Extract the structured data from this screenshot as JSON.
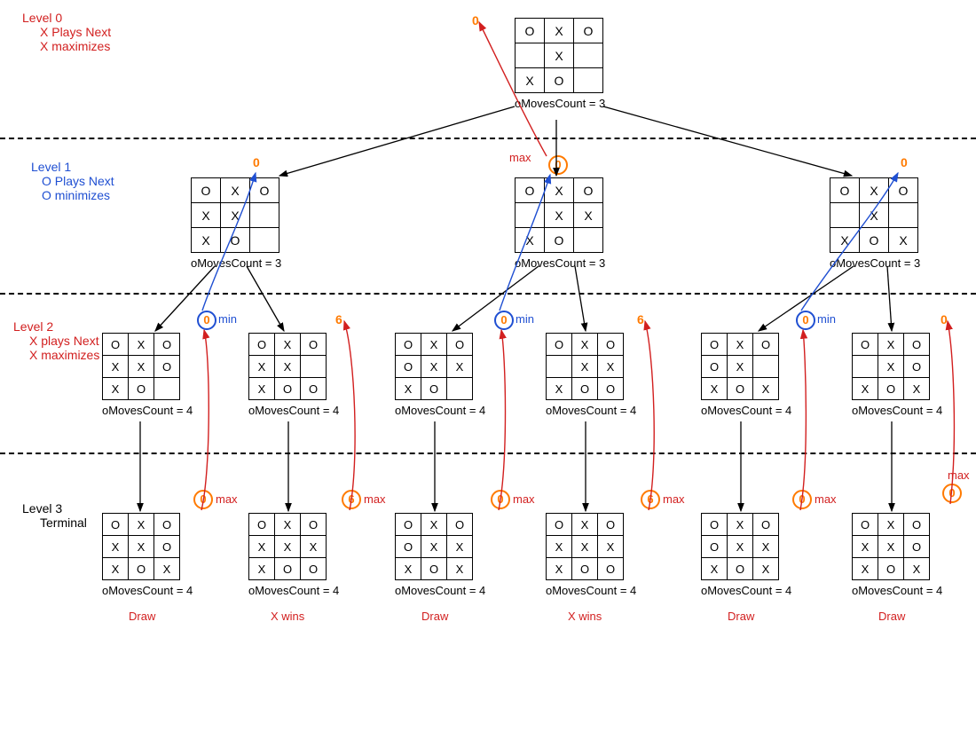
{
  "levels": {
    "l0": {
      "title": "Level 0",
      "line1": "X Plays Next",
      "line2": "X maximizes"
    },
    "l1": {
      "title": "Level 1",
      "line1": "O Plays Next",
      "line2": "O minimizes"
    },
    "l2": {
      "title": "Level 2",
      "line1": "X plays Next",
      "line2": "X maximizes"
    },
    "l3": {
      "title": "Level 3",
      "line1": "Terminal"
    }
  },
  "labels": {
    "max": "max",
    "min": "min",
    "oMoves3": "oMovesCount = 3",
    "oMoves4": "oMovesCount = 4"
  },
  "values": {
    "v0": "0",
    "v6": "6"
  },
  "results": {
    "draw": "Draw",
    "xwins": "X wins"
  },
  "boards": {
    "root": [
      "O",
      "X",
      "O",
      "",
      "X",
      "",
      "X",
      "O",
      ""
    ],
    "l1a": [
      "O",
      "X",
      "O",
      "X",
      "X",
      "",
      "X",
      "O",
      ""
    ],
    "l1b": [
      "O",
      "X",
      "O",
      "",
      "X",
      "X",
      "X",
      "O",
      ""
    ],
    "l1c": [
      "O",
      "X",
      "O",
      "",
      "X",
      "",
      "X",
      "O",
      "X"
    ],
    "l2a1": [
      "O",
      "X",
      "O",
      "X",
      "X",
      "O",
      "X",
      "O",
      ""
    ],
    "l2a2": [
      "O",
      "X",
      "O",
      "X",
      "X",
      "",
      "X",
      "O",
      "O"
    ],
    "l2b1": [
      "O",
      "X",
      "O",
      "O",
      "X",
      "X",
      "X",
      "O",
      ""
    ],
    "l2b2": [
      "O",
      "X",
      "O",
      "",
      "X",
      "X",
      "X",
      "O",
      "O"
    ],
    "l2c1": [
      "O",
      "X",
      "O",
      "O",
      "X",
      "",
      "X",
      "O",
      "X"
    ],
    "l2c2": [
      "O",
      "X",
      "O",
      "",
      "X",
      "O",
      "X",
      "O",
      "X"
    ],
    "l3a1": [
      "O",
      "X",
      "O",
      "X",
      "X",
      "O",
      "X",
      "O",
      "X"
    ],
    "l3a2": [
      "O",
      "X",
      "O",
      "X",
      "X",
      "X",
      "X",
      "O",
      "O"
    ],
    "l3b1": [
      "O",
      "X",
      "O",
      "O",
      "X",
      "X",
      "X",
      "O",
      "X"
    ],
    "l3b2": [
      "O",
      "X",
      "O",
      "X",
      "X",
      "X",
      "X",
      "O",
      "O"
    ],
    "l3c1": [
      "O",
      "X",
      "O",
      "O",
      "X",
      "X",
      "X",
      "O",
      "X"
    ],
    "l3c2": [
      "O",
      "X",
      "O",
      "X",
      "X",
      "O",
      "X",
      "O",
      "X"
    ]
  }
}
